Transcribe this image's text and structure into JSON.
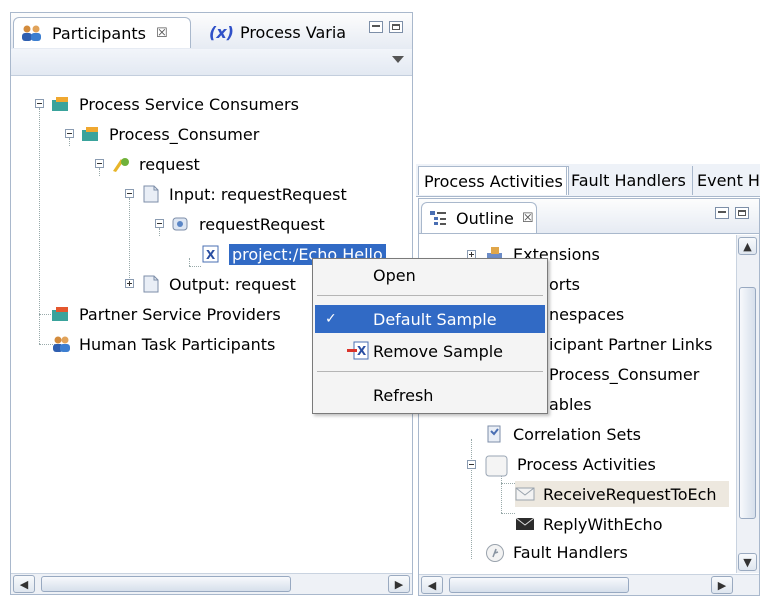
{
  "participants_panel": {
    "tab_participants": "Participants",
    "tab_close": "☒",
    "tab_variables_x": "(x)",
    "tab_variables": "Process Varia",
    "tree": [
      {
        "label": "Process Service Consumers"
      },
      {
        "label": "Process_Consumer"
      },
      {
        "label": "request"
      },
      {
        "label": "Input: requestRequest"
      },
      {
        "label": "requestRequest"
      },
      {
        "label": "project:/Echo Hello"
      },
      {
        "label": "Output: request"
      },
      {
        "label": "Partner Service Providers"
      },
      {
        "label": "Human Task Participants"
      }
    ]
  },
  "context_menu": {
    "items": [
      {
        "label": "Open"
      },
      {
        "label": "Default Sample",
        "check": "✓"
      },
      {
        "label": "Remove Sample"
      },
      {
        "label": "Refresh"
      }
    ]
  },
  "editor_tabs": [
    "Process Activities",
    "Fault Handlers",
    "Event H"
  ],
  "outline_panel": {
    "title": "Outline",
    "tab_close": "☒",
    "tree": [
      {
        "label": "Extensions"
      },
      {
        "label": "orts"
      },
      {
        "label": "nespaces"
      },
      {
        "label": "icipant Partner Links"
      },
      {
        "label": "Process_Consumer"
      },
      {
        "label": "ables"
      },
      {
        "label": "Correlation Sets"
      },
      {
        "label": "Process Activities"
      },
      {
        "label": "ReceiveRequestToEch"
      },
      {
        "label": "ReplyWithEcho"
      },
      {
        "label": "Fault Handlers"
      }
    ]
  },
  "colors": {
    "selection": "#316ac5",
    "panel_border": "#a9b8cc",
    "highlight_row": "#ede8df"
  }
}
